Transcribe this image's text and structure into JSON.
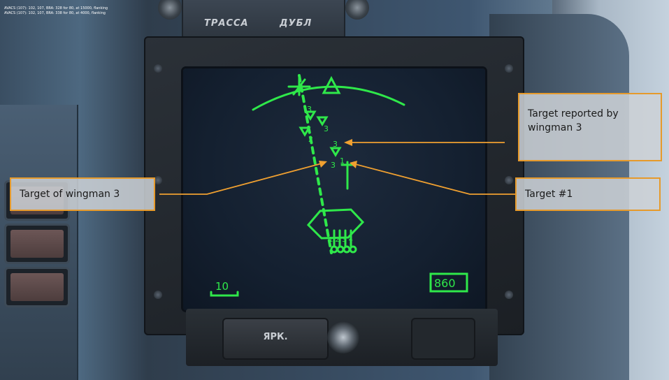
{
  "avacs": {
    "line1": "AVACS (107): 102, 107, BRA: 328 for 80, at 15000, flanking",
    "line2": "AVACS (107): 102, 107, BRA: 338 for 80, at 4000, flanking"
  },
  "panel": {
    "top_label_left": "ТРАССА",
    "top_label_right": "ДУБЛ",
    "bottom_button": "ЯРК."
  },
  "display": {
    "scale_value": "10",
    "speed_value": "860",
    "contact_labels": {
      "upper_left": "3",
      "upper_right": "3",
      "mid_left": "2",
      "reported": "3",
      "wingman_target": "3",
      "target_one": "1"
    },
    "wingman_numbers": "1 2 3 4",
    "phosphor_color": "#2fe84a"
  },
  "callouts": {
    "reported_by_wingman": "Target reported by wingman 3",
    "target_of_wingman": "Target of wingman 3",
    "target_one": "Target #1"
  },
  "colors": {
    "callout_border": "#e69a2b",
    "callout_fill": "#cdd2d6",
    "leader_line": "#f0a030"
  }
}
